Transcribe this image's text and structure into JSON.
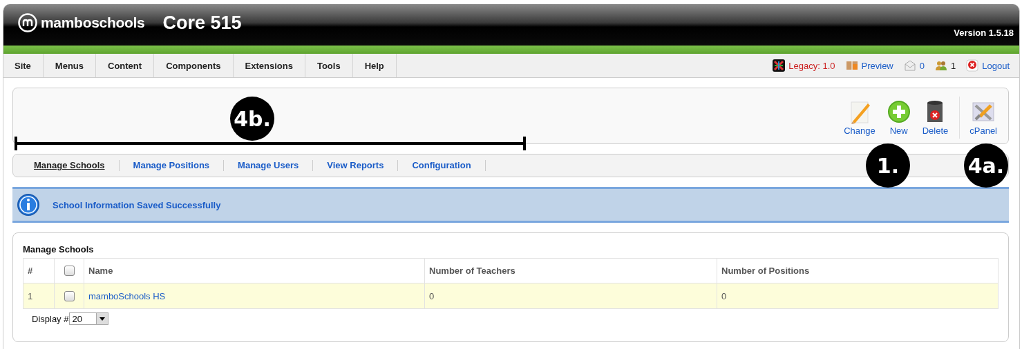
{
  "header": {
    "logo": "mamboschools",
    "title": "Core 515",
    "version": "Version 1.5.18"
  },
  "menu": [
    "Site",
    "Menus",
    "Content",
    "Components",
    "Extensions",
    "Tools",
    "Help"
  ],
  "status": [
    {
      "kind": "legacy",
      "text": "Legacy: 1.0"
    },
    {
      "kind": "preview",
      "text": "Preview"
    },
    {
      "kind": "messages",
      "text": "0"
    },
    {
      "kind": "users",
      "text": "1"
    },
    {
      "kind": "logout",
      "text": "Logout"
    }
  ],
  "toolbar": [
    {
      "kind": "change",
      "label": "Change"
    },
    {
      "kind": "new",
      "label": "New"
    },
    {
      "kind": "delete",
      "label": "Delete"
    },
    {
      "kind": "cpanel",
      "label": "cPanel"
    }
  ],
  "submenu": [
    {
      "label": "Manage Schools",
      "selected": true
    },
    {
      "label": "Manage Positions",
      "selected": false
    },
    {
      "label": "Manage Users",
      "selected": false
    },
    {
      "label": "View Reports",
      "selected": false
    },
    {
      "label": "Configuration",
      "selected": false
    }
  ],
  "message": "School Information Saved Successfully",
  "table": {
    "title": "Manage Schools",
    "columns": [
      "#",
      "",
      "Name",
      "Number of Teachers",
      "Number of Positions"
    ],
    "rows": [
      {
        "number": "1",
        "checked": false,
        "name": "mamboSchools HS",
        "teachers": "0",
        "positions": "0"
      }
    ],
    "header_checked": false
  },
  "display": {
    "label": "Display #",
    "value": "20"
  },
  "annotations": [
    {
      "kind": "bracket",
      "text": "4b."
    },
    {
      "kind": "marker",
      "text": "1."
    },
    {
      "kind": "marker",
      "text": "4a."
    }
  ]
}
